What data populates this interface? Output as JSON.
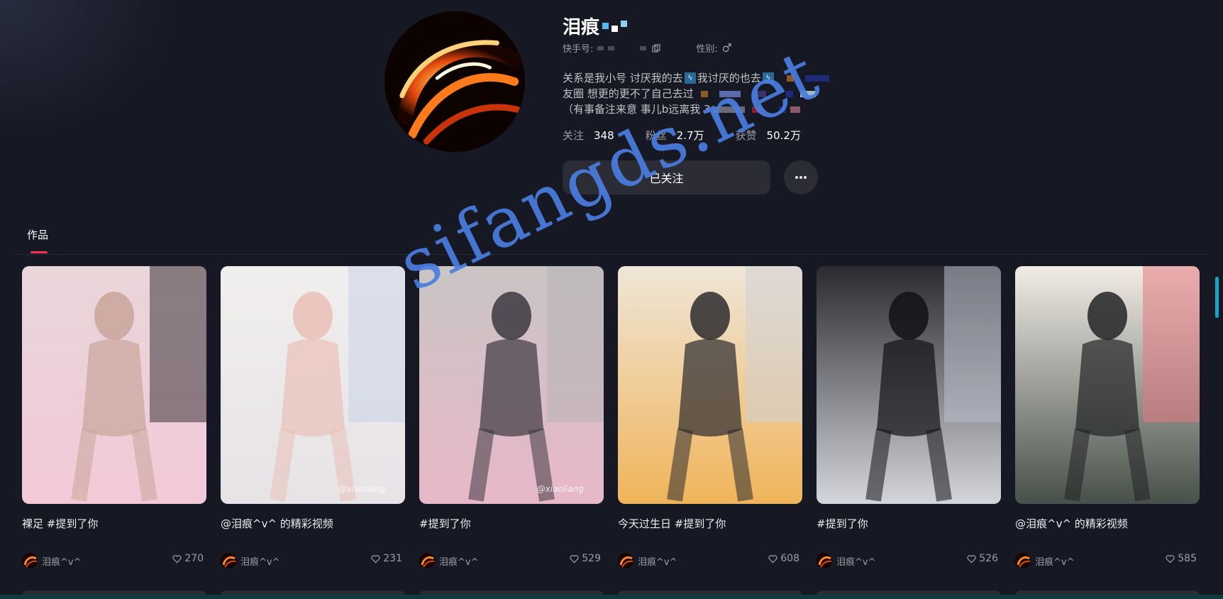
{
  "profile": {
    "nickname": "泪痕",
    "id_label": "快手号:",
    "gender_label": "性别:",
    "bio": [
      "关系是我小号 讨厌我的去",
      "我讨厌的也去",
      "友圈 想更的更不了自己去过",
      "（有事备注来意 事儿b远离我 3"
    ],
    "bio_badge": "ϟ",
    "stats": [
      {
        "label": "关注",
        "value": "348"
      },
      {
        "label": "粉丝",
        "value": "2.7万"
      },
      {
        "label": "获赞",
        "value": "50.2万"
      }
    ],
    "follow_button": "已关注",
    "more_button": "…"
  },
  "tabs": [
    {
      "label": "作品",
      "active": true
    }
  ],
  "videos": [
    {
      "caption": "裸足 #提到了你",
      "author": "泪痕^v^",
      "likes": "270",
      "overlay": ""
    },
    {
      "caption": "@泪痕^v^ 的精彩视频",
      "author": "泪痕^v^",
      "likes": "231",
      "overlay": "@xiaoliang"
    },
    {
      "caption": "#提到了你",
      "author": "泪痕^v^",
      "likes": "529",
      "overlay": "@xiaoliang"
    },
    {
      "caption": "今天过生日 #提到了你",
      "author": "泪痕^v^",
      "likes": "608",
      "overlay": ""
    },
    {
      "caption": "#提到了你",
      "author": "泪痕^v^",
      "likes": "526",
      "overlay": ""
    },
    {
      "caption": "@泪痕^v^ 的精彩视频",
      "author": "泪痕^v^",
      "likes": "585",
      "overlay": ""
    }
  ],
  "watermark": "sifangds.net",
  "colors": {
    "background": "#161823",
    "accent": "#fe2c55",
    "button": "#2b2c36",
    "watermark": "#4a7ee0"
  },
  "icons": {
    "copy": "copy-icon",
    "gender": "male-icon",
    "like": "heart-icon",
    "more": "more-icon"
  }
}
